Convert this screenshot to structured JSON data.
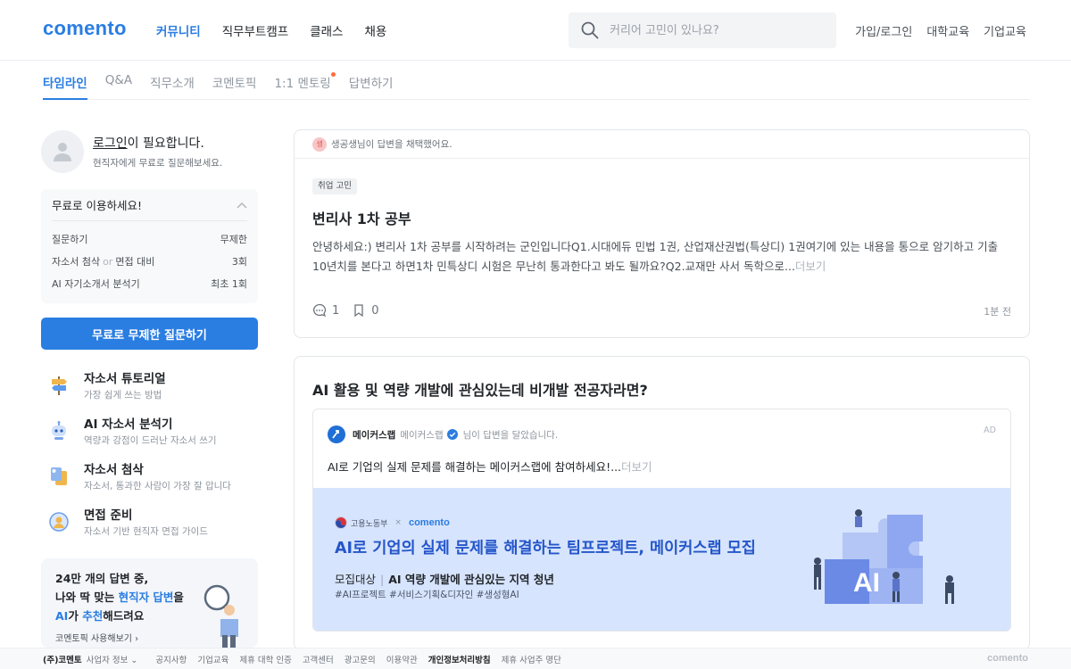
{
  "header": {
    "logo": "comento",
    "nav": [
      "커뮤니티",
      "직무부트캠프",
      "클래스",
      "채용"
    ],
    "search_placeholder": "커리어 고민이 있나요?",
    "links": [
      "가입/로그인",
      "대학교육",
      "기업교육"
    ]
  },
  "tabs": [
    "타임라인",
    "Q&A",
    "직무소개",
    "코멘토픽",
    "1:1 멘토링",
    "답변하기"
  ],
  "sidebar": {
    "login_link": "로그인",
    "login_suffix": "이 필요합니다.",
    "login_sub": "현직자에게 무료로 질문해보세요.",
    "usage_title": "무료로 이용하세요!",
    "usage_rows": [
      {
        "label": "질문하기",
        "value": "무제한"
      },
      {
        "label_a": "자소서 첨삭",
        "label_or": "or",
        "label_b": "면접 대비",
        "value": "3회"
      },
      {
        "label": "AI 자기소개서 분석기",
        "value": "최초 1회"
      }
    ],
    "cta": "무료로 무제한 질문하기",
    "menu": [
      {
        "title": "자소서 튜토리얼",
        "sub": "가장 쉽게 쓰는 방법"
      },
      {
        "title": "AI 자소서 분석기",
        "sub": "역량과 강점이 드러난 자소서 쓰기"
      },
      {
        "title": "자소서 첨삭",
        "sub": "자소서, 통과한 사람이 가장 잘 압니다"
      },
      {
        "title": "면접 준비",
        "sub": "자소서 기반 현직자 면접 가이드"
      }
    ],
    "promo": {
      "line1": "24만 개의 답변 중,",
      "line2_a": "나와 딱 맞는 ",
      "line2_b": "현직자 답변",
      "line2_c": "을",
      "line3_a": "AI",
      "line3_b": "가 ",
      "line3_c": "추천",
      "line3_d": "해드려요",
      "link": "코멘토픽 사용해보기"
    }
  },
  "feed": {
    "card1": {
      "activity_avatar": "생",
      "activity": "생공생님이 답변을 채택했어요.",
      "tag": "취업 고민",
      "title": "변리사 1차 공부",
      "body": "안녕하세요:) 변리사 1차 공부를 시작하려는 군인입니다Q1.시대에듀 민법 1권, 산업재산권법(특상디) 1권여기에 있는 내용을 통으로 암기하고 기출10년치를 본다고 하면1차 민특상디 시험은 무난히 통과한다고 봐도 될까요?Q2.교재만 사서 독학으로...",
      "more": "더보기",
      "comments": "1",
      "bookmarks": "0",
      "time": "1분 전"
    },
    "card2": {
      "title": "AI 활용 및 역량 개발에 관심있는데 비개발 전공자라면?",
      "brand": "메이커스랩",
      "brand_sub": "메이커스랩",
      "activity": "님이 답변을 달았습니다.",
      "ad": "AD",
      "text": "AI로 기업의 실제 문제를 해결하는 메이커스랩에 참여하세요!...",
      "more": "더보기",
      "banner": {
        "org": "고용노동부",
        "x": "×",
        "partner": "comento",
        "title": "AI로 기업의 실제 문제를 해결하는 팀프로젝트, 메이커스랩 모집",
        "target_label": "모집대상",
        "target": "AI 역량 개발에 관심있는 지역 청년",
        "tags": "#AI프로젝트 #서비스기획&디자인 #생성형AI"
      }
    }
  },
  "footer": {
    "corp": "(주)코멘토",
    "info": "사업자 정보",
    "links": [
      "공지사항",
      "기업교육",
      "제휴 대학 인증",
      "고객센터",
      "광고문의",
      "이용약관",
      "개인정보처리방침",
      "제휴 사업주 명단"
    ],
    "logo": "comento"
  },
  "colors": {
    "accent": "#2a7de1",
    "banner_bg": "#d7e4fd",
    "banner_title": "#2456c9"
  }
}
